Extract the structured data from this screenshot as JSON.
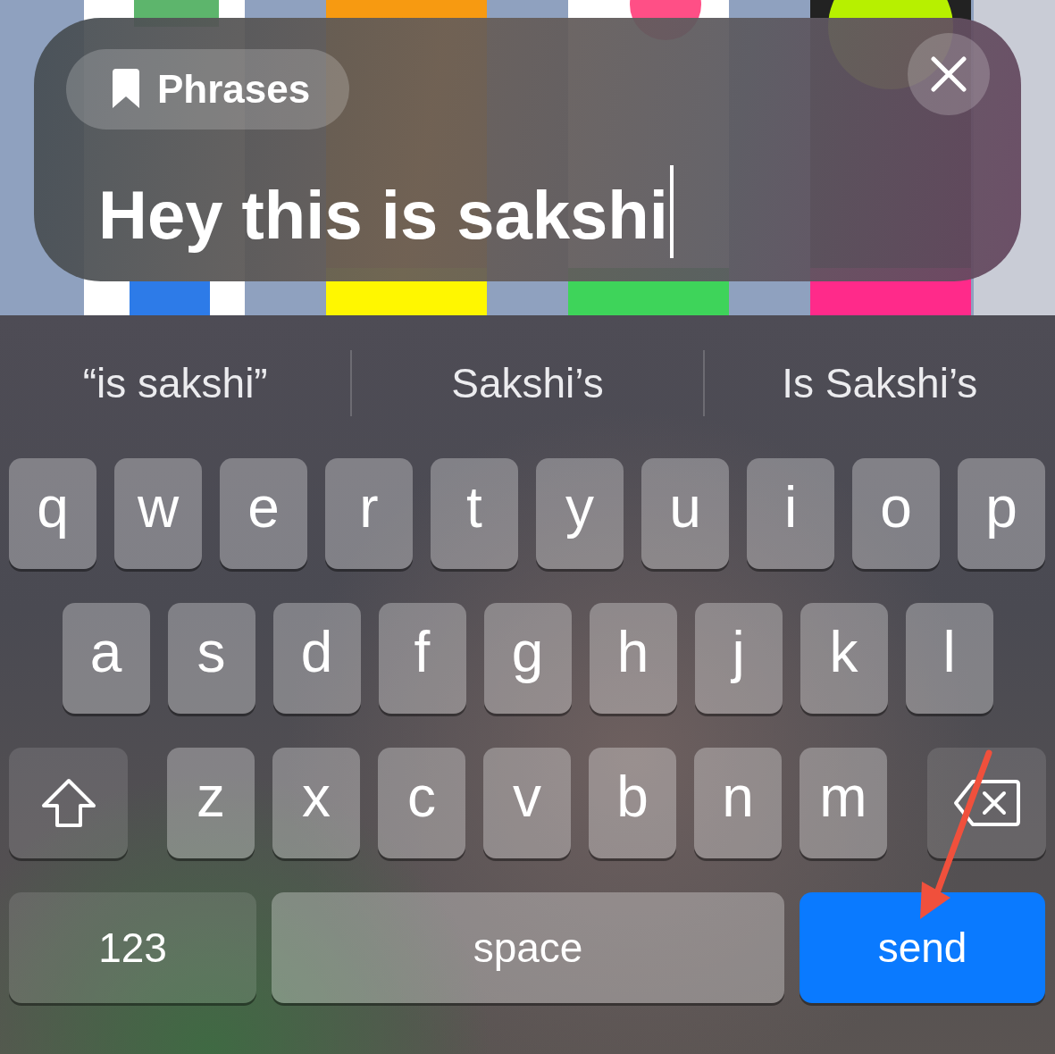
{
  "phrase_panel": {
    "chip": {
      "label": "Phrases"
    },
    "field": {
      "value": "Hey this is sakshi"
    }
  },
  "suggestions": [
    "“is sakshi”",
    "Sakshi’s",
    "Is Sakshi’s"
  ],
  "keyboard": {
    "rows": [
      {
        "keys": [
          {
            "kind": "letter",
            "label": "q"
          },
          {
            "kind": "letter",
            "label": "w"
          },
          {
            "kind": "letter",
            "label": "e"
          },
          {
            "kind": "letter",
            "label": "r"
          },
          {
            "kind": "letter",
            "label": "t"
          },
          {
            "kind": "letter",
            "label": "y"
          },
          {
            "kind": "letter",
            "label": "u"
          },
          {
            "kind": "letter",
            "label": "i"
          },
          {
            "kind": "letter",
            "label": "o"
          },
          {
            "kind": "letter",
            "label": "p"
          }
        ]
      },
      {
        "keys": [
          {
            "kind": "letter",
            "label": "a"
          },
          {
            "kind": "letter",
            "label": "s"
          },
          {
            "kind": "letter",
            "label": "d"
          },
          {
            "kind": "letter",
            "label": "f"
          },
          {
            "kind": "letter",
            "label": "g"
          },
          {
            "kind": "letter",
            "label": "h"
          },
          {
            "kind": "letter",
            "label": "j"
          },
          {
            "kind": "letter",
            "label": "k"
          },
          {
            "kind": "letter",
            "label": "l"
          }
        ]
      },
      {
        "keys": [
          {
            "kind": "shift"
          },
          {
            "kind": "letter",
            "label": "z"
          },
          {
            "kind": "letter",
            "label": "x"
          },
          {
            "kind": "letter",
            "label": "c"
          },
          {
            "kind": "letter",
            "label": "v"
          },
          {
            "kind": "letter",
            "label": "b"
          },
          {
            "kind": "letter",
            "label": "n"
          },
          {
            "kind": "letter",
            "label": "m"
          },
          {
            "kind": "delete"
          }
        ]
      },
      {
        "keys": [
          {
            "kind": "numbers",
            "label": "123"
          },
          {
            "kind": "space",
            "label": "space"
          },
          {
            "kind": "send",
            "label": "send"
          }
        ]
      }
    ]
  }
}
